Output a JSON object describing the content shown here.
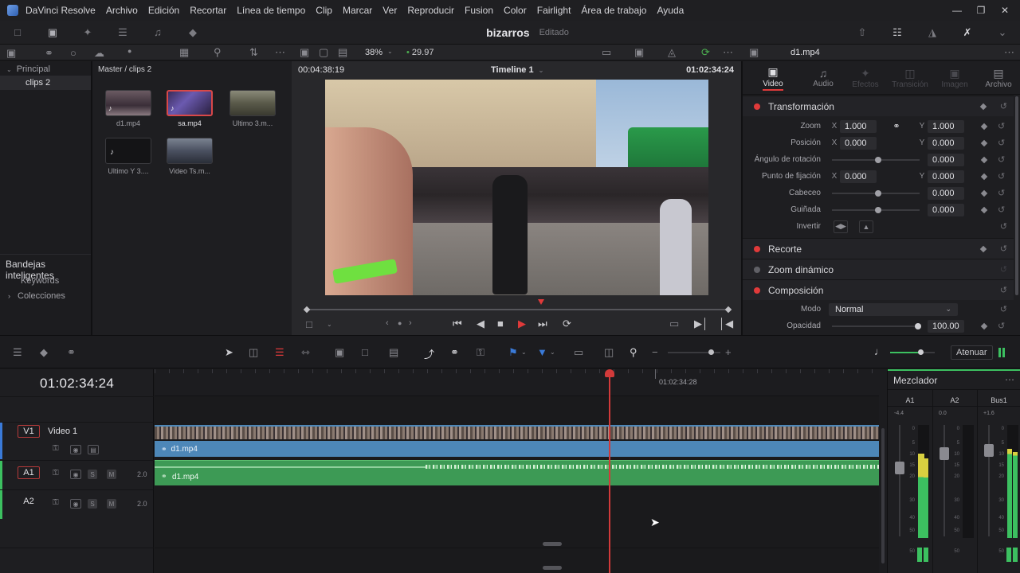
{
  "app": {
    "name": "DaVinci Resolve",
    "menus": [
      "Archivo",
      "Edición",
      "Recortar",
      "Línea de tiempo",
      "Clip",
      "Marcar",
      "Ver",
      "Reproducir",
      "Fusion",
      "Color",
      "Fairlight",
      "Área de trabajo",
      "Ayuda"
    ]
  },
  "project": {
    "title": "bizarros",
    "status": "Editado"
  },
  "viewer": {
    "zoom": "38%",
    "fps": "29.97",
    "source_timecode": "00:04:38:19",
    "timeline_name": "Timeline 1",
    "record_timecode": "01:02:34:24"
  },
  "media_pool": {
    "bins": {
      "root": "Principal",
      "selected": "clips 2"
    },
    "path": "Master / clips 2",
    "clips": [
      {
        "name": "d1.mp4",
        "kind": "video"
      },
      {
        "name": "sa.mp4",
        "kind": "video-audio"
      },
      {
        "name": "Ultimo 3.m...",
        "kind": "video"
      },
      {
        "name": "Ultimo Y 3....",
        "kind": "audio"
      },
      {
        "name": "Video Ts.m...",
        "kind": "video"
      }
    ],
    "smart_bins": {
      "title": "Bandejas inteligentes",
      "items": [
        "Keywords",
        "Colecciones"
      ]
    }
  },
  "inspector": {
    "clip_name": "d1.mp4",
    "tabs": [
      "Video",
      "Audio",
      "Efectos",
      "Transición",
      "Imagen",
      "Archivo"
    ],
    "transform": {
      "title": "Transformación",
      "zoom_label": "Zoom",
      "zoom_x": "1.000",
      "zoom_y": "1.000",
      "position_label": "Posición",
      "position_x": "0.000",
      "position_y": "0.000",
      "rotation_label": "Ángulo de rotación",
      "rotation": "0.000",
      "anchor_label": "Punto de fijación",
      "anchor_x": "0.000",
      "anchor_y": "0.000",
      "pitch_label": "Cabeceo",
      "pitch": "0.000",
      "yaw_label": "Guiñada",
      "yaw": "0.000",
      "flip_label": "Invertir",
      "axis_x": "X",
      "axis_y": "Y"
    },
    "sections": {
      "crop": "Recorte",
      "dynamic_zoom": "Zoom dinámico",
      "composite": "Composición"
    },
    "composite": {
      "mode_label": "Modo",
      "mode": "Normal",
      "opacity_label": "Opacidad",
      "opacity": "100.00"
    }
  },
  "timeline": {
    "timecode": "01:02:34:24",
    "ruler_mark": "01:02:34:28",
    "tracks": [
      {
        "id": "V1",
        "name": "Video 1",
        "clip": "d1.mp4"
      },
      {
        "id": "A1",
        "level": "2.0",
        "clip": "d1.mp4"
      },
      {
        "id": "A2",
        "level": "2.0"
      }
    ],
    "mute_button": "Atenuar",
    "solo": "S",
    "mute": "M"
  },
  "mixer": {
    "title": "Mezclador",
    "channels": [
      {
        "name": "A1",
        "level": "-4.4"
      },
      {
        "name": "A2",
        "level": "0.0"
      },
      {
        "name": "Bus1",
        "level": "+1.6"
      }
    ],
    "scale": [
      "0",
      "5",
      "10",
      "15",
      "20",
      "30",
      "40",
      "50",
      "50"
    ]
  },
  "colors": {
    "accent_red": "#e03a3a",
    "video_clip": "#4d87b8",
    "audio_clip": "#3d9a55",
    "playhead": "#d23a3a"
  }
}
